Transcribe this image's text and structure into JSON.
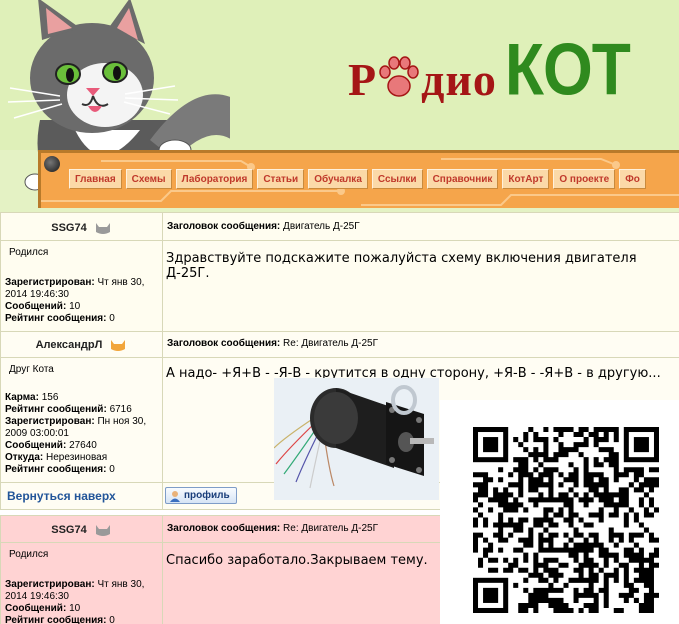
{
  "nav": {
    "items": [
      "Главная",
      "Схемы",
      "Лаборатория",
      "Статьи",
      "Обучалка",
      "Ссылки",
      "Справочник",
      "КотАрт",
      "О проекте",
      "Фо"
    ]
  },
  "logo": {
    "part1": "Р",
    "part2": "дио",
    "part3": "КОТ"
  },
  "labels": {
    "subject": "Заголовок сообщения:",
    "registered": "Зарегистрирован:",
    "messages": "Сообщений:",
    "rating": "Рейтинг сообщения:",
    "karma": "Карма:",
    "rating_msgs": "Рейтинг сообщений:",
    "from": "Откуда:",
    "back_to_top": "Вернуться наверх",
    "profile": "профиль"
  },
  "posts": [
    {
      "author": "SSG74",
      "rank": "Родился",
      "subject": "Двигатель Д-25Г",
      "registered": "Чт янв 30, 2014 19:46:30",
      "messages": "10",
      "rating": "0",
      "text": "Здравствуйте подскажите пожалуйста схему включения двигателя Д-25Г."
    },
    {
      "author": "АлександрЛ",
      "rank": "Друг Кота",
      "subject": "Re: Двигатель Д-25Г",
      "karma": "156",
      "rating_msgs": "6716",
      "registered": "Пн ноя 30, 2009 03:00:01",
      "messages": "27640",
      "from": "Нерезиновая",
      "rating": "0",
      "text": "А надо- +Я+В - -Я-В - крутится в одну сторону, +Я-В - -Я+В - в другую..."
    },
    {
      "author": "SSG74",
      "rank": "Родился",
      "subject": "Re: Двигатель Д-25Г",
      "registered": "Чт янв 30, 2014 19:46:30",
      "messages": "10",
      "rating": "0",
      "text": "Спасибо заработало.Закрываем тему."
    }
  ],
  "colors": {
    "header_bg": "#e4f2c4",
    "nav_bg": "#f5a54b",
    "nav_text": "#c0392b",
    "logo_red": "#a51616",
    "logo_green": "#2f8a1e",
    "post3_bg": "#ffd3d3"
  }
}
